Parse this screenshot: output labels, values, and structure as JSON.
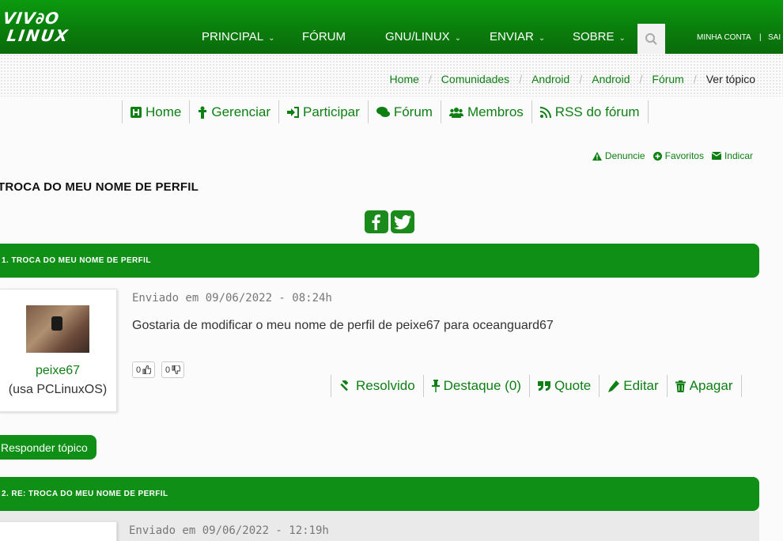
{
  "header": {
    "logo_line1": "VIVA O",
    "logo_line2": "LINUX",
    "nav": [
      {
        "label": "PRINCIPAL",
        "has_dropdown": true
      },
      {
        "label": "FÓRUM",
        "has_dropdown": false
      },
      {
        "label": "GNU/LINUX",
        "has_dropdown": true
      },
      {
        "label": "ENVIAR",
        "has_dropdown": true
      },
      {
        "label": "SOBRE",
        "has_dropdown": true
      }
    ],
    "account": "MINHA CONTA",
    "separator": "|",
    "logout": "SAI"
  },
  "breadcrumb": [
    {
      "label": "Home"
    },
    {
      "label": "Comunidades"
    },
    {
      "label": "Android"
    },
    {
      "label": "Android"
    },
    {
      "label": "Fórum"
    },
    {
      "label": "Ver tópico"
    }
  ],
  "community_menu": [
    {
      "label": "Home",
      "icon": "home-icon"
    },
    {
      "label": "Gerenciar",
      "icon": "manage-icon"
    },
    {
      "label": "Participar",
      "icon": "sign-in-icon"
    },
    {
      "label": "Fórum",
      "icon": "comments-icon"
    },
    {
      "label": "Membros",
      "icon": "users-icon"
    },
    {
      "label": "RSS do fórum",
      "icon": "rss-icon"
    }
  ],
  "topic_actions": {
    "report": "Denuncie",
    "favorites": "Favoritos",
    "share": "Indicar"
  },
  "topic_title": "TROCA DO MEU NOME DE PERFIL",
  "posts": [
    {
      "header": "1. TROCA DO MEU NOME DE PERFIL",
      "author": "peixe67",
      "os": "(usa PCLinuxOS)",
      "date": "Enviado em 09/06/2022 - 08:24h",
      "body": "Gostaria de modificar o meu nome de perfil de peixe67 para oceanguard67",
      "likes": "0",
      "dislikes": "0",
      "actions": {
        "solved": "Resolvido",
        "highlight": "Destaque (0)",
        "quote": "Quote",
        "edit": "Editar",
        "delete": "Apagar"
      }
    },
    {
      "header": "2. RE: TROCA DO MEU NOME DE PERFIL",
      "date": "Enviado em 09/06/2022 - 12:19h"
    }
  ],
  "reply_button": "Responder tópico",
  "colors": {
    "brand_green": "#0f8f15",
    "link_green": "#0d7f13"
  }
}
